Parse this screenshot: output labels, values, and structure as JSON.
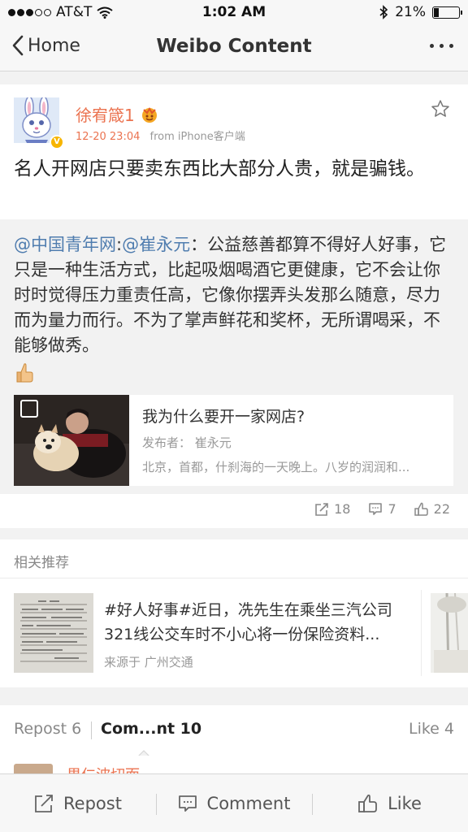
{
  "status_bar": {
    "carrier": "AT&T",
    "time": "1:02 AM",
    "battery_percent": "21%",
    "battery_level": 0.21
  },
  "nav": {
    "back_label": "Home",
    "title": "Weibo Content"
  },
  "post": {
    "username": "徐宥箴1",
    "time": "12-20 23:04",
    "source": "from iPhone客户端",
    "text": "名人开网店只要卖东西比大部分人贵，就是骗钱。",
    "repost": {
      "mention1": "@中国青年网",
      "sep": ":",
      "mention2": "@崔永元",
      "text": "：公益慈善都算不得好人好事，它只是一种生活方式，比起吸烟喝酒它更健康，它不会让你时时觉得压力重责任高，它像你摆弄头发那么随意，尽力而为量力而行。不为了掌声鲜花和奖杯，无所谓喝采，不能够做秀。",
      "card": {
        "title": "我为什么要开一家网店?",
        "author": "发布者：  崔永元",
        "desc": "北京，首都，什刹海的一天晚上。八岁的润润和..."
      }
    },
    "counts": {
      "repost": "18",
      "comment": "7",
      "like": "22"
    }
  },
  "related": {
    "header": "相关推荐",
    "item": {
      "title": "#好人好事#近日，冼先生在乘坐三汽公司321线公交车时不小心将一份保险资料...",
      "source": "来源于  广州交通"
    }
  },
  "tabs": {
    "repost": "Repost 6",
    "comment": "Com...nt 10",
    "like": "Like 4"
  },
  "comment_peek": {
    "name": "果仁波切而"
  },
  "toolbar": {
    "repost": "Repost",
    "comment": "Comment",
    "like": "Like"
  }
}
